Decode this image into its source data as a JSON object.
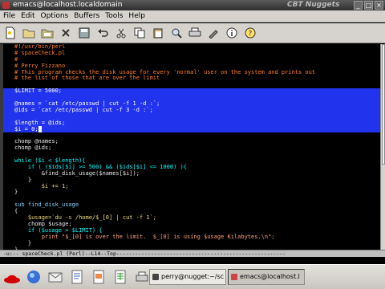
{
  "window": {
    "title": "emacs@localhost.localdomain",
    "watermark": "CBT Nuggets"
  },
  "menu": [
    "File",
    "Edit",
    "Options",
    "Buffers",
    "Tools",
    "Help"
  ],
  "toolbar_icons": [
    "new-file-icon",
    "open-folder-icon",
    "dired-icon",
    "close-icon",
    "save-icon",
    "undo-icon",
    "cut-icon",
    "copy-icon",
    "paste-icon",
    "search-icon",
    "print-icon",
    "preferences-icon",
    "info-icon",
    "help-icon"
  ],
  "code_lines": [
    {
      "text": "#!/usr/bin/perl",
      "cls": "c-comment",
      "hl": false
    },
    {
      "text": "# spaceCheck.pl",
      "cls": "c-comment",
      "hl": false
    },
    {
      "text": "#",
      "cls": "c-comment",
      "hl": false
    },
    {
      "text": "# Perry Fizzano",
      "cls": "c-comment",
      "hl": false
    },
    {
      "text": "# This program checks the disk usage for every 'normal' user on the system and prints out",
      "cls": "c-comment",
      "hl": false
    },
    {
      "text": "# the list of those that are over the limit",
      "cls": "c-comment",
      "hl": false
    },
    {
      "text": "",
      "cls": "c-plain",
      "hl": false
    },
    {
      "text": "$LIMIT = 5000;",
      "cls": "c-var",
      "hl": true
    },
    {
      "text": "",
      "cls": "c-plain",
      "hl": true
    },
    {
      "text": "@names = `cat /etc/passwd | cut -f 1 -d :`;",
      "cls": "c-var",
      "hl": true
    },
    {
      "text": "@ids = `cat /etc/passwd | cut -f 3 -d :`;",
      "cls": "c-var",
      "hl": true
    },
    {
      "text": "",
      "cls": "c-plain",
      "hl": true
    },
    {
      "text": "$length = @ids;",
      "cls": "c-var",
      "hl": true
    },
    {
      "text": "$i = 0;",
      "cls": "c-var",
      "hl": true,
      "cursor": true
    },
    {
      "text": "",
      "cls": "c-plain",
      "hl": false
    },
    {
      "text": "chomp @names;",
      "cls": "c-plain",
      "hl": false
    },
    {
      "text": "chomp @ids;",
      "cls": "c-plain",
      "hl": false
    },
    {
      "text": "",
      "cls": "c-plain",
      "hl": false
    },
    {
      "text": "while ($i < $length){",
      "cls": "c-kw",
      "hl": false
    },
    {
      "text": "    if ( ($ids[$i] >= 500) && ($ids[$i] <= 1000) ){",
      "cls": "c-kw",
      "hl": false
    },
    {
      "text": "        &find_disk_usage($names[$i]);",
      "cls": "c-plain",
      "hl": false
    },
    {
      "text": "    }",
      "cls": "c-plain",
      "hl": false
    },
    {
      "text": "        $i += 1;",
      "cls": "c-var",
      "hl": false
    },
    {
      "text": "}",
      "cls": "c-plain",
      "hl": false
    },
    {
      "text": "",
      "cls": "c-plain",
      "hl": false
    },
    {
      "text": "sub find_disk_usage",
      "cls": "c-fn",
      "hl": false
    },
    {
      "text": "{",
      "cls": "c-plain",
      "hl": false
    },
    {
      "text": "    $usage=`du -s /home/$_[0] | cut -f 1`;",
      "cls": "c-var",
      "hl": false
    },
    {
      "text": "    chomp $usage;",
      "cls": "c-plain",
      "hl": false
    },
    {
      "text": "    if ($usage > $LIMIT) {",
      "cls": "c-kw",
      "hl": false
    },
    {
      "text": "        print \"$_[0] is over the limit.  $_[0] is using $usage Kilabytes.\\n\";",
      "cls": "c-string",
      "hl": false
    },
    {
      "text": "    }",
      "cls": "c-plain",
      "hl": false
    },
    {
      "text": "}",
      "cls": "c-plain",
      "hl": false
    }
  ],
  "modeline": "-u:--  spaceCheck.pl        (Perl)--L14--Top------------------------------------------------------",
  "taskbar": {
    "tasks": [
      {
        "label": "perry@nugget:~/sc",
        "active": false
      },
      {
        "label": "emacs@localhost.l",
        "active": true
      }
    ]
  },
  "colors": {
    "selection": "#2233ee",
    "comment": "#ff7f24",
    "variable": "#eedd82",
    "keyword": "#00ffff"
  }
}
